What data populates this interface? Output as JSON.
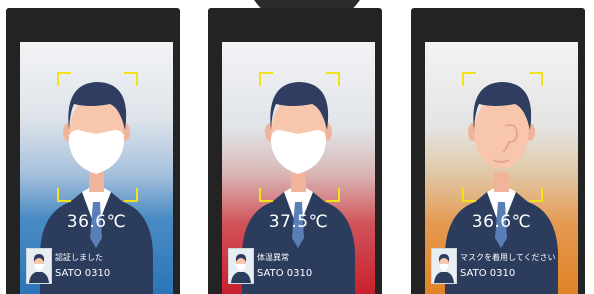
{
  "devices": [
    {
      "variant": "masked",
      "status_color": "#2b76b8",
      "temperature": "36.6℃",
      "status": "認証しました",
      "user": "SATO 0310"
    },
    {
      "variant": "masked",
      "status_color": "#c9202d",
      "temperature": "37.5℃",
      "status": "体温異常",
      "user": "SATO 0310"
    },
    {
      "variant": "unmasked",
      "status_color": "#e08326",
      "temperature": "36.6℃",
      "status": "マスクを着用してください",
      "user": "SATO 0310"
    }
  ],
  "bracket_color": "#f2e21a"
}
